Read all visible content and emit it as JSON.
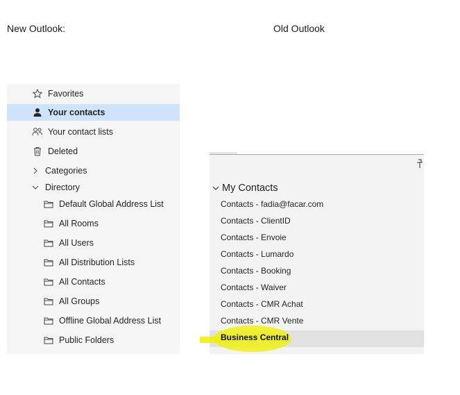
{
  "captions": {
    "new": "New Outlook:",
    "old": "Old Outlook"
  },
  "new_outlook": {
    "items": [
      {
        "label": "Favorites",
        "icon": "star-icon"
      },
      {
        "label": "Your contacts",
        "icon": "person-icon",
        "selected": true
      },
      {
        "label": "Your contact lists",
        "icon": "people-icon"
      },
      {
        "label": "Deleted",
        "icon": "trash-icon"
      },
      {
        "label": "Categories",
        "icon": "chevron-right-icon"
      },
      {
        "label": "Directory",
        "icon": "chevron-down-icon"
      },
      {
        "label": "Default Global Address List",
        "icon": "folder-icon"
      },
      {
        "label": "All Rooms",
        "icon": "folder-icon"
      },
      {
        "label": "All Users",
        "icon": "folder-icon"
      },
      {
        "label": "All Distribution Lists",
        "icon": "folder-icon"
      },
      {
        "label": "All Contacts",
        "icon": "folder-icon"
      },
      {
        "label": "All Groups",
        "icon": "folder-icon"
      },
      {
        "label": "Offline Global Address List",
        "icon": "folder-icon"
      },
      {
        "label": "Public Folders",
        "icon": "folder-icon"
      }
    ]
  },
  "old_outlook": {
    "group_label": "My Contacts",
    "items": [
      "Contacts - fadia@facar.com",
      "Contacts - ClientID",
      "Contacts - Envoie",
      "Contacts - Lumardo",
      "Contacts - Booking",
      "Contacts - Waiver",
      "Contacts - CMR Achat",
      "Contacts - CMR Vente",
      "Business Central"
    ],
    "selected_index": 8
  },
  "colors": {
    "selected_new": "#cfe4fa",
    "highlight": "#f0f000"
  }
}
